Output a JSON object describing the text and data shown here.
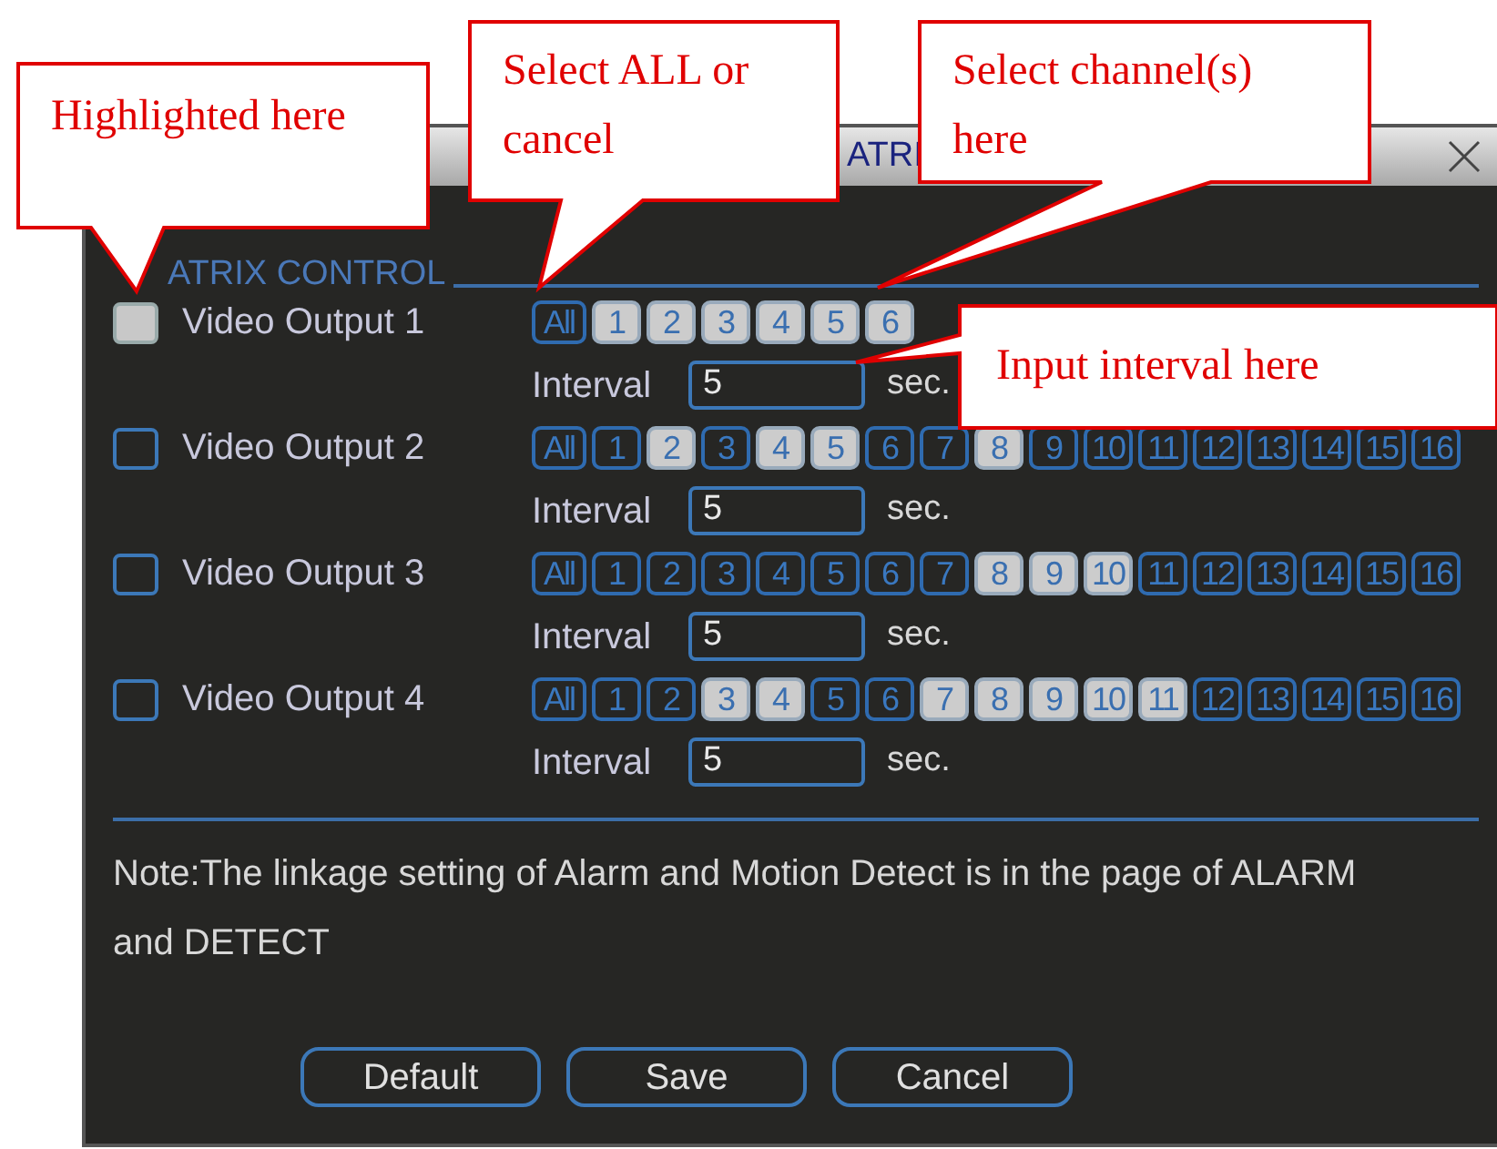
{
  "window": {
    "title": "ATRI"
  },
  "section": {
    "title": "ATRIX CONTROL"
  },
  "outputs": [
    {
      "label": "Video Output 1",
      "highlighted": true,
      "all": {
        "label": "All",
        "selected": false
      },
      "channels": [
        {
          "label": "1",
          "selected": true
        },
        {
          "label": "2",
          "selected": true
        },
        {
          "label": "3",
          "selected": true
        },
        {
          "label": "4",
          "selected": true
        },
        {
          "label": "5",
          "selected": true
        },
        {
          "label": "6",
          "selected": true
        }
      ],
      "interval": {
        "label": "Interval",
        "value": "5",
        "unit": "sec."
      }
    },
    {
      "label": "Video Output 2",
      "highlighted": false,
      "all": {
        "label": "All",
        "selected": false
      },
      "channels": [
        {
          "label": "1",
          "selected": false
        },
        {
          "label": "2",
          "selected": true
        },
        {
          "label": "3",
          "selected": false
        },
        {
          "label": "4",
          "selected": true
        },
        {
          "label": "5",
          "selected": true
        },
        {
          "label": "6",
          "selected": false
        },
        {
          "label": "7",
          "selected": false
        },
        {
          "label": "8",
          "selected": true
        },
        {
          "label": "9",
          "selected": false
        },
        {
          "label": "10",
          "selected": false
        },
        {
          "label": "11",
          "selected": false
        },
        {
          "label": "12",
          "selected": false
        },
        {
          "label": "13",
          "selected": false
        },
        {
          "label": "14",
          "selected": false
        },
        {
          "label": "15",
          "selected": false
        },
        {
          "label": "16",
          "selected": false
        }
      ],
      "interval": {
        "label": "Interval",
        "value": "5",
        "unit": "sec."
      }
    },
    {
      "label": "Video Output 3",
      "highlighted": false,
      "all": {
        "label": "All",
        "selected": false
      },
      "channels": [
        {
          "label": "1",
          "selected": false
        },
        {
          "label": "2",
          "selected": false
        },
        {
          "label": "3",
          "selected": false
        },
        {
          "label": "4",
          "selected": false
        },
        {
          "label": "5",
          "selected": false
        },
        {
          "label": "6",
          "selected": false
        },
        {
          "label": "7",
          "selected": false
        },
        {
          "label": "8",
          "selected": true
        },
        {
          "label": "9",
          "selected": true
        },
        {
          "label": "10",
          "selected": true
        },
        {
          "label": "11",
          "selected": false
        },
        {
          "label": "12",
          "selected": false
        },
        {
          "label": "13",
          "selected": false
        },
        {
          "label": "14",
          "selected": false
        },
        {
          "label": "15",
          "selected": false
        },
        {
          "label": "16",
          "selected": false
        }
      ],
      "interval": {
        "label": "Interval",
        "value": "5",
        "unit": "sec."
      }
    },
    {
      "label": "Video Output 4",
      "highlighted": false,
      "all": {
        "label": "All",
        "selected": false
      },
      "channels": [
        {
          "label": "1",
          "selected": false
        },
        {
          "label": "2",
          "selected": false
        },
        {
          "label": "3",
          "selected": true
        },
        {
          "label": "4",
          "selected": true
        },
        {
          "label": "5",
          "selected": false
        },
        {
          "label": "6",
          "selected": false
        },
        {
          "label": "7",
          "selected": true
        },
        {
          "label": "8",
          "selected": true
        },
        {
          "label": "9",
          "selected": true
        },
        {
          "label": "10",
          "selected": true
        },
        {
          "label": "11",
          "selected": true
        },
        {
          "label": "12",
          "selected": false
        },
        {
          "label": "13",
          "selected": false
        },
        {
          "label": "14",
          "selected": false
        },
        {
          "label": "15",
          "selected": false
        },
        {
          "label": "16",
          "selected": false
        }
      ],
      "interval": {
        "label": "Interval",
        "value": "5",
        "unit": "sec."
      }
    }
  ],
  "note": "Note:The linkage setting of Alarm and Motion Detect is in the page of ALARM and DETECT",
  "buttons": [
    "Default",
    "Save",
    "Cancel"
  ],
  "callouts": [
    "Highlighted here",
    "Select ALL or cancel",
    "Select channel(s) here",
    "Input interval here"
  ]
}
